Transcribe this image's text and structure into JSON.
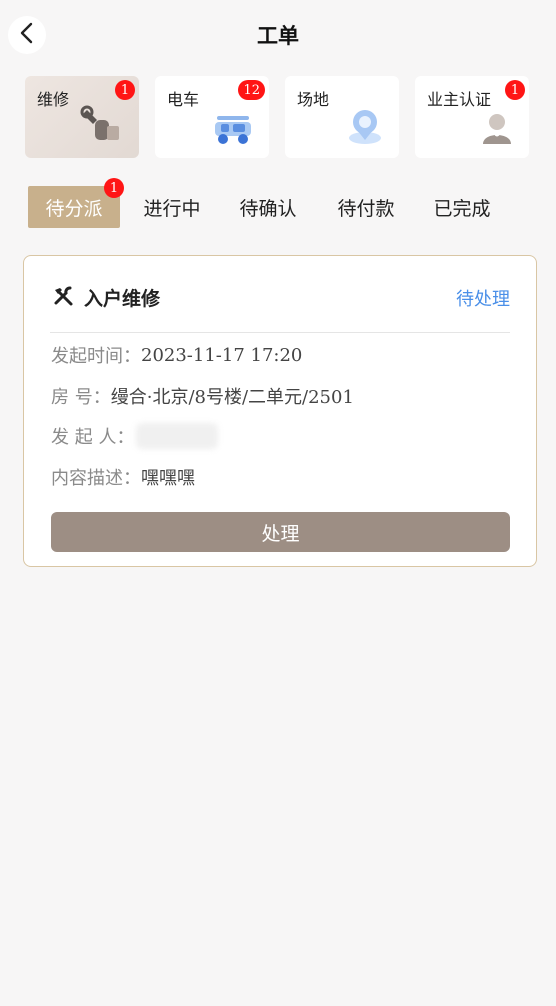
{
  "header": {
    "title": "工单"
  },
  "categories": [
    {
      "label": "维修",
      "badge": "1",
      "icon": "wrench-hand-icon",
      "active": true
    },
    {
      "label": "电车",
      "badge": "12",
      "icon": "golf-cart-icon",
      "active": false
    },
    {
      "label": "场地",
      "badge": "",
      "icon": "location-pin-icon",
      "active": false
    },
    {
      "label": "业主认证",
      "badge": "1",
      "icon": "user-avatar-icon",
      "active": false
    }
  ],
  "tabs": [
    {
      "label": "待分派",
      "badge": "1",
      "active": true
    },
    {
      "label": "进行中",
      "badge": "",
      "active": false
    },
    {
      "label": "待确认",
      "badge": "",
      "active": false
    },
    {
      "label": "待付款",
      "badge": "",
      "active": false
    },
    {
      "label": "已完成",
      "badge": "",
      "active": false
    }
  ],
  "order": {
    "title": "入户维修",
    "status": "待处理",
    "time_label": "发起时间：",
    "time_value": "2023-11-17 17:20",
    "room_label": "房 号：",
    "room_value": "缦合·北京/8号楼/二单元/2501",
    "initiator_label": "发 起 人：",
    "desc_label": "内容描述：",
    "desc_value": "嘿嘿嘿",
    "action_label": "处理"
  },
  "colors": {
    "accent": "#c8b08c",
    "badge": "#ff1515",
    "status": "#4a8fe8",
    "button": "#9d8e84",
    "card_border": "#d9c6a4"
  }
}
